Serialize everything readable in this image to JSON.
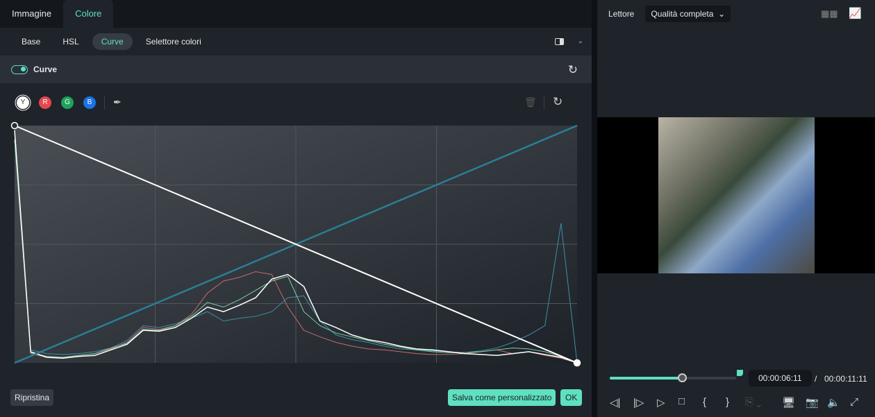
{
  "tabs": [
    {
      "label": "Immagine"
    },
    {
      "label": "Colore"
    }
  ],
  "subtabs": [
    {
      "label": "Base"
    },
    {
      "label": "HSL"
    },
    {
      "label": "Curve"
    },
    {
      "label": "Selettore colori"
    }
  ],
  "section": {
    "label": "Curve",
    "enabled": true
  },
  "channels": [
    {
      "label": "Y",
      "color": "#ffffff"
    },
    {
      "label": "R",
      "color": "#e5484d"
    },
    {
      "label": "G",
      "color": "#1fa35a"
    },
    {
      "label": "B",
      "color": "#1a73e8"
    }
  ],
  "curve": {
    "y_points": [
      [
        0,
        255
      ],
      [
        255,
        0
      ]
    ],
    "reference_line": [
      [
        0,
        0
      ],
      [
        255,
        255
      ]
    ],
    "reference_color": "#2a7f94"
  },
  "histogram": {
    "luma": [
      250,
      12,
      6,
      5,
      7,
      8,
      14,
      20,
      35,
      34,
      38,
      48,
      60,
      55,
      62,
      70,
      90,
      95,
      82,
      45,
      38,
      30,
      25,
      22,
      18,
      15,
      14,
      12,
      10,
      9,
      8,
      10,
      12,
      9,
      6,
      0
    ],
    "red": [
      240,
      10,
      6,
      6,
      8,
      10,
      15,
      22,
      38,
      36,
      40,
      52,
      75,
      88,
      92,
      98,
      95,
      60,
      35,
      28,
      22,
      18,
      15,
      14,
      12,
      10,
      9,
      9,
      10,
      12,
      14,
      10,
      12,
      8,
      5,
      0
    ],
    "green": [
      240,
      11,
      7,
      6,
      8,
      10,
      16,
      21,
      36,
      35,
      40,
      50,
      65,
      60,
      68,
      78,
      88,
      93,
      55,
      40,
      32,
      28,
      24,
      20,
      17,
      14,
      12,
      11,
      11,
      12,
      14,
      16,
      15,
      12,
      7,
      0
    ],
    "blue": [
      240,
      14,
      10,
      9,
      10,
      12,
      16,
      24,
      40,
      38,
      42,
      48,
      55,
      45,
      48,
      50,
      55,
      70,
      72,
      45,
      30,
      25,
      22,
      18,
      15,
      14,
      13,
      12,
      11,
      13,
      16,
      22,
      30,
      40,
      150,
      0
    ]
  },
  "footer": {
    "reset": "Ripristina",
    "save": "Salva come personalizzato",
    "ok": "OK"
  },
  "player": {
    "label": "Lettore",
    "quality": "Qualità completa",
    "current_time": "00:00:06:11",
    "separator": "/",
    "total_time": "00:00:11:11",
    "progress": 0.57
  },
  "accent": "#5fe0c0"
}
